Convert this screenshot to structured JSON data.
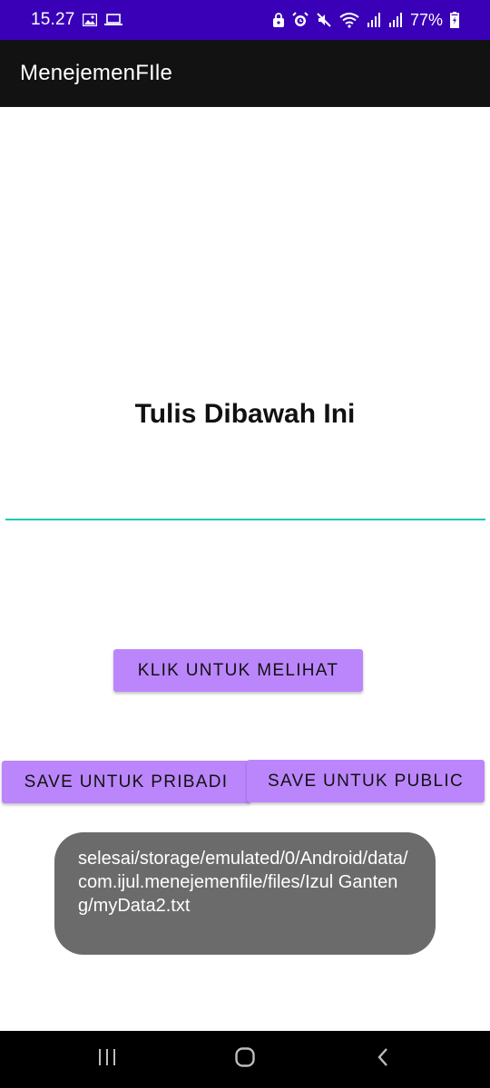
{
  "status_bar": {
    "time": "15.27",
    "battery": "77%",
    "icons": [
      "image-icon",
      "screen-cast-icon",
      "lock-icon",
      "alarm-icon",
      "mute-icon",
      "wifi-icon",
      "signal-icon",
      "signal-icon",
      "battery-charging-icon"
    ]
  },
  "app_bar": {
    "title": "MenejemenFIle"
  },
  "main": {
    "heading": "Tulis Dibawah Ini",
    "input_value": "",
    "view_button": "KLIK UNTUK MELIHAT",
    "save_private_button": "SAVE UNTUK PRIBADI",
    "save_public_button": "SAVE UNTUK PUBLIC"
  },
  "toast": {
    "message": "selesai/storage/emulated/0/Android/data/com.ijul.menejemenfile/files/Izul Ganteng/myData2.txt"
  },
  "nav_bar": {
    "icons": [
      "recent-apps-icon",
      "home-icon",
      "back-icon"
    ]
  },
  "colors": {
    "status_bar": "#3a00b8",
    "app_bar": "#121212",
    "button": "#bb86fc",
    "input_underline": "#1fc7b6",
    "toast": "#6b6b6b"
  }
}
